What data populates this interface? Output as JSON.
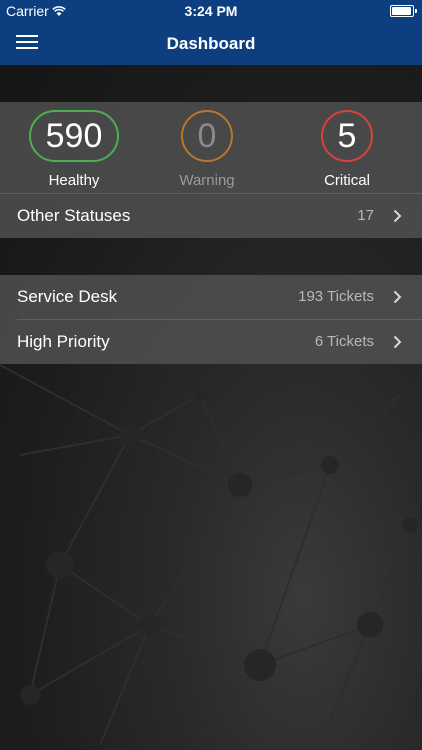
{
  "status_bar": {
    "carrier": "Carrier",
    "time": "3:24 PM"
  },
  "header": {
    "title": "Dashboard"
  },
  "statuses": [
    {
      "value": "590",
      "label": "Healthy",
      "color": "#4bb04f"
    },
    {
      "value": "0",
      "label": "Warning",
      "color": "#b8782c"
    },
    {
      "value": "5",
      "label": "Critical",
      "color": "#d9423a"
    }
  ],
  "other_statuses": {
    "label": "Other Statuses",
    "value": "17"
  },
  "tickets": [
    {
      "label": "Service Desk",
      "value": "193 Tickets"
    },
    {
      "label": "High Priority",
      "value": "6 Tickets"
    }
  ],
  "icons": {
    "menu": "hamburger-menu-icon",
    "chevron": "chevron-right-icon",
    "wifi": "wifi-icon",
    "battery": "battery-icon"
  }
}
